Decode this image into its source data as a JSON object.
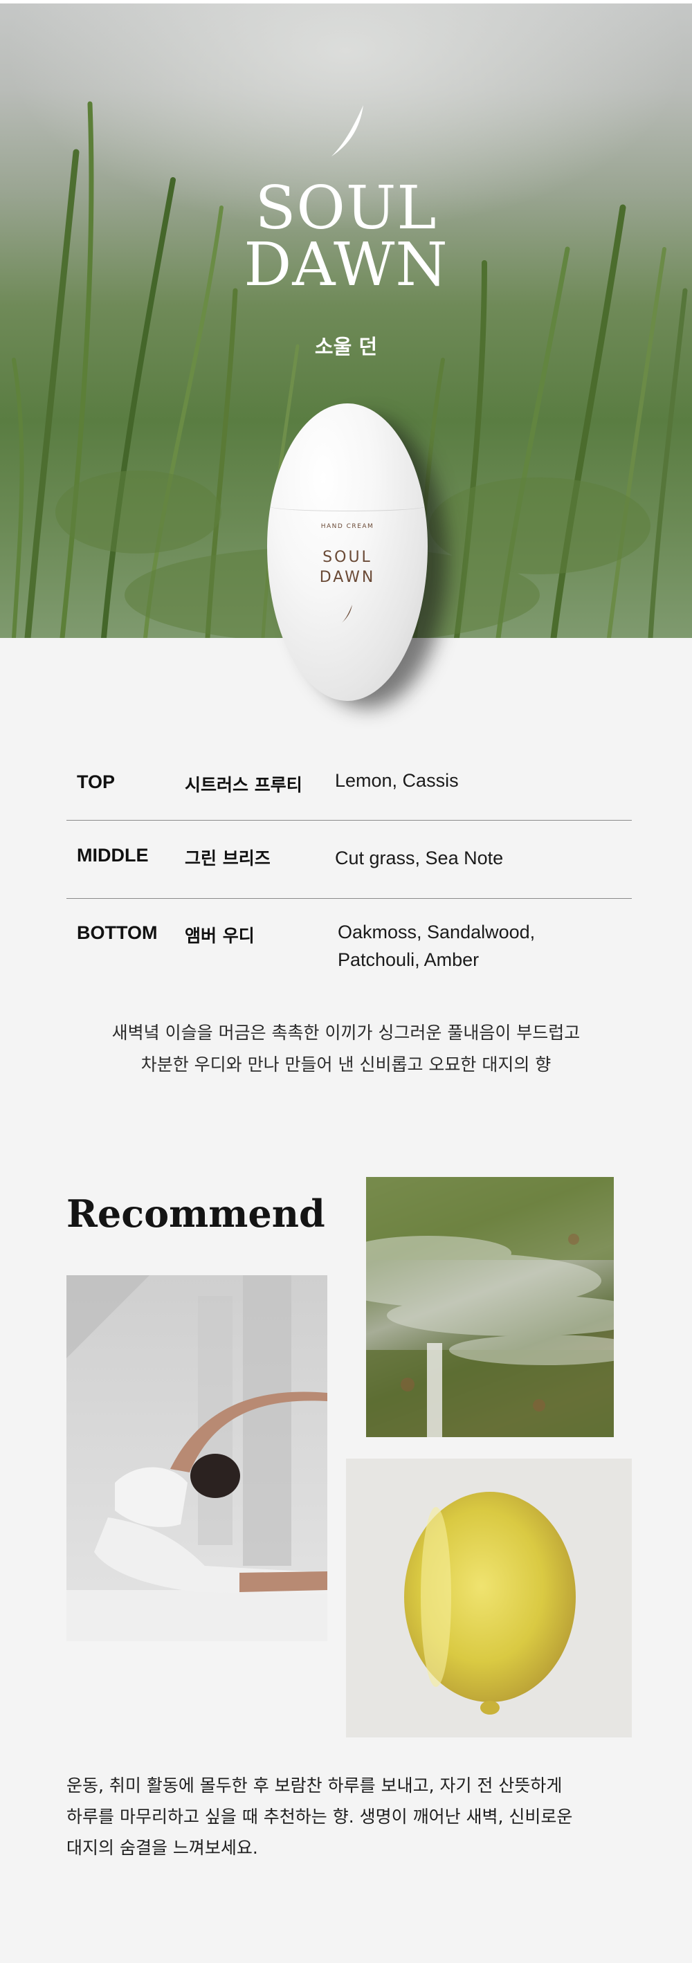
{
  "hero": {
    "brand_line1": "SOUL",
    "brand_line2": "DAWN",
    "brand_korean": "소울 던"
  },
  "product": {
    "sub_label": "HAND CREAM",
    "name_line1": "SOUL",
    "name_line2": "DAWN"
  },
  "notes": [
    {
      "tier": "TOP",
      "korean": "시트러스 프루티",
      "english": "Lemon, Cassis"
    },
    {
      "tier": "MIDDLE",
      "korean": "그린 브리즈",
      "english": "Cut grass, Sea Note"
    },
    {
      "tier": "BOTTOM",
      "korean": "앰버 우디",
      "english_line1": "Oakmoss, Sandalwood,",
      "english_line2": "Patchouli, Amber"
    }
  ],
  "scent_description": {
    "line1": "새벽녘 이슬을 머금은 촉촉한 이끼가 싱그러운 풀내음이 부드럽고",
    "line2": "차분한 우디와 만나 만들어 낸 신비롭고 오묘한 대지의 향"
  },
  "recommend": {
    "title": "Recommend"
  },
  "closing": {
    "line1": "운동, 취미 활동에 몰두한 후 보람찬 하루를 보내고, 자기 전 산뜻하게",
    "line2": "하루를 마무리하고 싶을 때 추천하는 향. 생명이 깨어난 새벽, 신비로운",
    "line3": "대지의 숨결을 느껴보세요."
  },
  "colors": {
    "background": "#f4f4f4",
    "brand_brown": "#6a4a36",
    "divider": "#8a8a8a"
  }
}
